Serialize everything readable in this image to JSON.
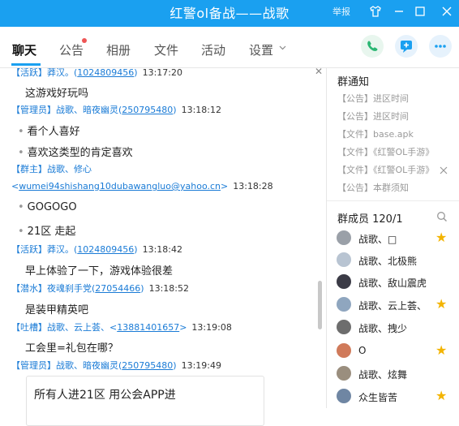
{
  "window": {
    "title": "红警ol备战——战歌",
    "report": "举报",
    "colors": {
      "accent": "#1aa0f0",
      "link": "#1a7bd6",
      "star": "#f3b400"
    }
  },
  "tabs": [
    {
      "label": "聊天"
    },
    {
      "label": "公告"
    },
    {
      "label": "相册"
    },
    {
      "label": "文件"
    },
    {
      "label": "活动"
    },
    {
      "label": "设置"
    }
  ],
  "messages": [
    {
      "role": "【活跃】",
      "nick": "莽汉。(",
      "qq": "1024809456",
      "qq_suffix": ")",
      "time": "13:17:20"
    },
    {
      "text": "这游戏好玩吗"
    },
    {
      "role": "【管理员】",
      "nick": "战歌、暗夜幽灵(",
      "qq": "250795480",
      "qq_suffix": ")",
      "time": "13:18:12"
    },
    {
      "text": "看个人喜好"
    },
    {
      "text": "喜欢这类型的肯定喜欢"
    },
    {
      "role": "【群主】",
      "nick": "战歌、修心"
    },
    {
      "email": "wumei94shishang10dubawangluo@yahoo.cn",
      "time": "13:18:28"
    },
    {
      "text": "GOGOGO"
    },
    {
      "text": "21区 走起"
    },
    {
      "role": "【活跃】",
      "nick": "莽汉。(",
      "qq": "1024809456",
      "qq_suffix": ")",
      "time": "13:18:42"
    },
    {
      "text": "早上体验了一下，游戏体验很差"
    },
    {
      "role": "【潜水】",
      "nick": "夜魂刹手党(",
      "qq": "27054466",
      "qq_suffix": ")",
      "time": "13:18:52"
    },
    {
      "text": "是装甲精英吧"
    },
    {
      "role": "【吐槽】",
      "nick": "战歌、云上荟、<",
      "qq": "13881401657",
      "qq_suffix": ">",
      "time": "13:19:08"
    },
    {
      "text": "工会里=礼包在哪？"
    },
    {
      "role": "【管理员】",
      "nick": "战歌、暗夜幽灵(",
      "qq": "250795480",
      "qq_suffix": ")",
      "time": "13:19:49"
    }
  ],
  "card": {
    "title": "所有人进21区 用公会APP进"
  },
  "notices": {
    "title": "群通知",
    "items": [
      "【公告】进区时间",
      "【公告】进区时间",
      "【文件】base.apk",
      "【文件】《红警OL手游》",
      "【文件】《红警OL手游》",
      "【公告】本群须知"
    ]
  },
  "members": {
    "title": "群成员 120/1",
    "list": [
      {
        "name": "战歌、□",
        "avatar": "#9aa0a8",
        "star": true
      },
      {
        "name": "战歌、北极熊",
        "avatar": "#b8c4d2",
        "star": false
      },
      {
        "name": "战歌、敌山震虎",
        "avatar": "#3b3b46",
        "star": false
      },
      {
        "name": "战歌、云上荟、",
        "avatar": "#8fa6bf",
        "star": true
      },
      {
        "name": "战歌、拽少",
        "avatar": "#6d6d6d",
        "star": false
      },
      {
        "name": "O",
        "avatar": "#d07a5a",
        "star": true
      },
      {
        "name": "战歌、炫舞",
        "avatar": "#9a8e7e",
        "star": false
      },
      {
        "name": "众生皆苦",
        "avatar": "#6f86a3",
        "star": true
      }
    ]
  }
}
